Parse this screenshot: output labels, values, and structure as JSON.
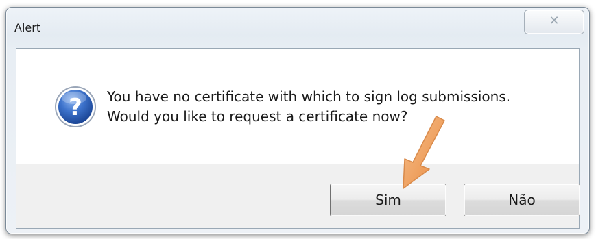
{
  "dialog": {
    "title": "Alert",
    "close_glyph": "✕",
    "message_line1": "You have no certificate with which to sign log submissions.",
    "message_line2": "Would you like to request a certificate now?",
    "icon": "question-icon",
    "buttons": {
      "yes_label": "Sim",
      "no_label": "Não"
    }
  },
  "annotation": {
    "arrow_color": "#f2a25f",
    "points_to": "yes-button"
  },
  "colors": {
    "icon_blue": "#2b5fb8",
    "footer_bg": "#f0f0f0"
  }
}
